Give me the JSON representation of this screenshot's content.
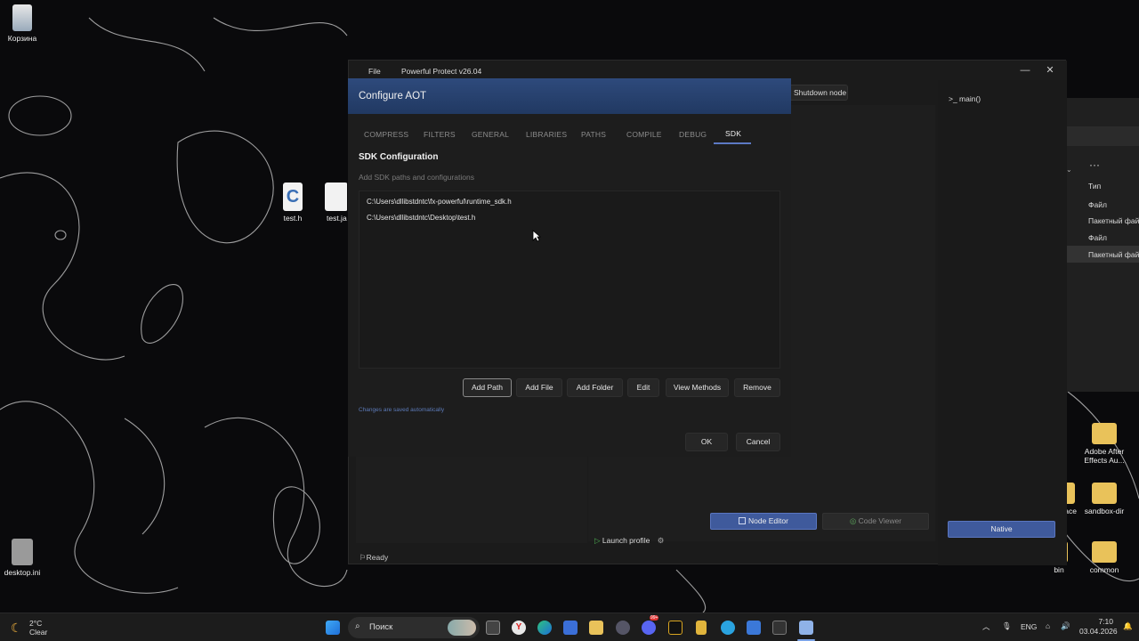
{
  "desktop": {
    "icons": [
      {
        "label": "Корзина"
      },
      {
        "label": "test.h"
      },
      {
        "label": "test.jar"
      },
      {
        "label": "desktop.ini"
      },
      {
        "label": "Adobe After Effects Au..."
      },
      {
        "label": "sandbox-dir"
      },
      {
        "label": "ace"
      },
      {
        "label": "bin"
      },
      {
        "label": "common"
      }
    ]
  },
  "explorer": {
    "more": "···",
    "col_type": "Тип",
    "rows": [
      "Файл",
      "Пакетный файл",
      "Файл",
      "Пакетный файл"
    ]
  },
  "app": {
    "menu_file": "File",
    "title": "Powerful Protect v26.04",
    "shutdown_label": "Shutdown node",
    "main_fn": ">_ main()",
    "node_editor": "Node Editor",
    "code_viewer": "Code Viewer",
    "native": "Native",
    "launch_profile": "Launch profile",
    "status": "Ready"
  },
  "dialog": {
    "title": "Configure AOT",
    "tabs": [
      "COMPRESS",
      "FILTERS",
      "GENERAL",
      "LIBRARIES",
      "PATHS",
      "COMPILE",
      "DEBUG",
      "SDK"
    ],
    "active_tab": "SDK",
    "section_title": "SDK Configuration",
    "section_subtitle": "Add SDK paths and configurations",
    "paths": [
      "C:\\Users\\dllibstdntc\\fx-powerful\\runtime_sdk.h",
      "C:\\Users\\dllibstdntc\\Desktop\\test.h"
    ],
    "buttons": {
      "add_path": "Add Path",
      "add_file": "Add File",
      "add_folder": "Add Folder",
      "edit": "Edit",
      "view_methods": "View Methods",
      "remove": "Remove"
    },
    "autosave_note": "Changes are saved automatically",
    "ok": "OK",
    "cancel": "Cancel"
  },
  "taskbar": {
    "weather_temp": "2°C",
    "weather_desc": "Clear",
    "search_placeholder": "Поиск",
    "lang": "ENG",
    "time": "7:10",
    "date": "03.04.2026",
    "badge": "99+"
  },
  "colors": {
    "accent": "#3f5a9c",
    "dialog_header": "#2e4a7c",
    "tab_underline": "#5c79c4"
  }
}
